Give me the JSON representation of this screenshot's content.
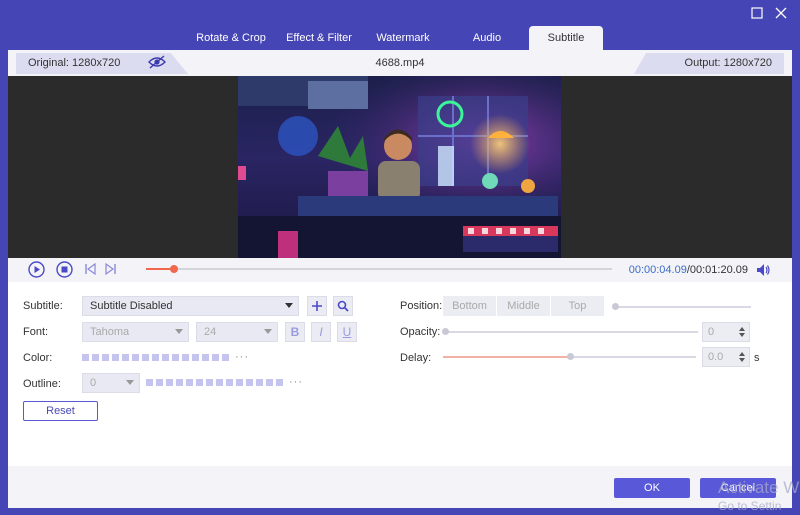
{
  "tabs": [
    {
      "label": "Rotate & Crop",
      "active": false
    },
    {
      "label": "Effect & Filter",
      "active": false
    },
    {
      "label": "Watermark",
      "active": false
    },
    {
      "label": "Audio",
      "active": false
    },
    {
      "label": "Subtitle",
      "active": true
    }
  ],
  "info": {
    "original": "Original: 1280x720",
    "filename": "4688.mp4",
    "output": "Output: 1280x720"
  },
  "playback": {
    "current_time": "00:00:04.09",
    "total_time": "/00:01:20.09",
    "progress": 0.06
  },
  "subtitle": {
    "label": "Subtitle:",
    "value": "Subtitle Disabled"
  },
  "font": {
    "label": "Font:",
    "family": "Tahoma",
    "size": "24",
    "bold": "B",
    "italic": "I",
    "underline": "U"
  },
  "color": {
    "label": "Color:",
    "ellipsis": "···"
  },
  "outline": {
    "label": "Outline:",
    "value": "0",
    "ellipsis": "···"
  },
  "reset_label": "Reset",
  "position": {
    "label": "Position:",
    "options": [
      "Bottom",
      "Middle",
      "Top"
    ]
  },
  "opacity": {
    "label": "Opacity:",
    "value": "0",
    "level": 0.0
  },
  "delay": {
    "label": "Delay:",
    "value": "0.0",
    "unit": "s",
    "level": 0.5
  },
  "footer": {
    "ok": "OK",
    "cancel": "Cancel"
  },
  "watermark": {
    "line1": "Activate W",
    "line2": "Go to Settin"
  },
  "colors": {
    "accent": "#5858d8",
    "titlebar": "#4545b5",
    "timeline": "#f0674e",
    "time": "#3c6cc8"
  }
}
